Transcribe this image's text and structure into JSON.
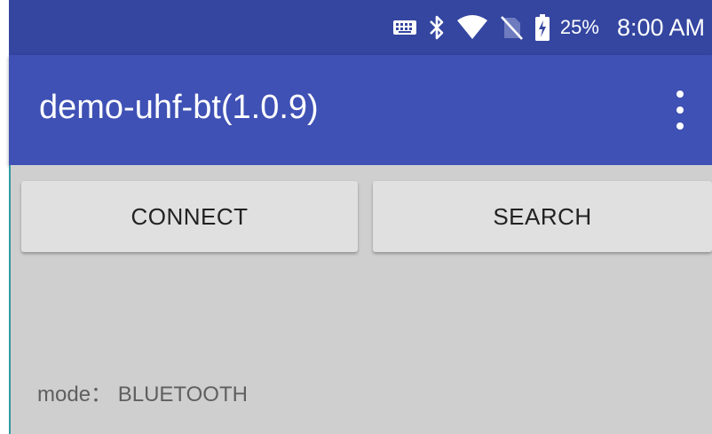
{
  "status_bar": {
    "icons": [
      "keyboard-icon",
      "bluetooth-icon",
      "wifi-icon",
      "no-sim-icon",
      "battery-charging-icon"
    ],
    "battery_percent": "25%",
    "time": "8:00 AM"
  },
  "app_bar": {
    "title": "demo-uhf-bt(1.0.9)",
    "menu_icon": "overflow-menu-icon"
  },
  "buttons": {
    "connect_label": "CONNECT",
    "search_label": "SEARCH"
  },
  "mode": {
    "label": "mode：",
    "value": "BLUETOOTH"
  },
  "colors": {
    "status_bar": "#3446a0",
    "app_bar": "#3f51b5",
    "content_bg": "#cfcfcf",
    "button_bg": "#e0e0e0"
  }
}
